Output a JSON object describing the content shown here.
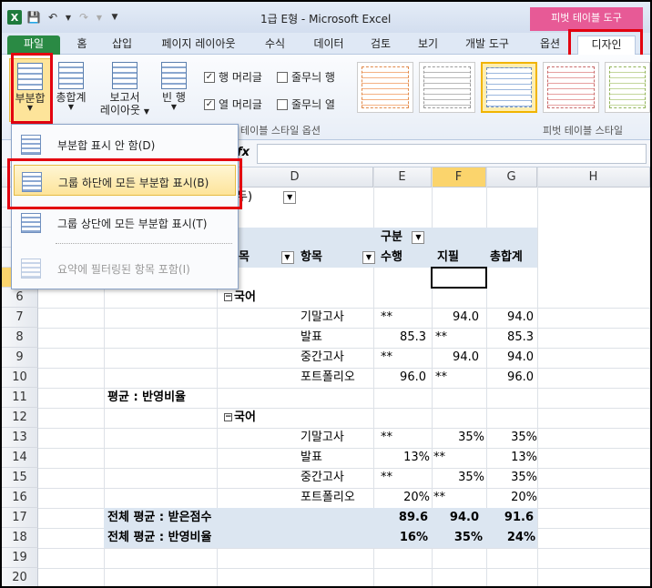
{
  "title": {
    "text": "1급 E형  -  Microsoft Excel",
    "context_group": "피벗 테이블 도구"
  },
  "tabs": [
    "파일",
    "홈",
    "삽입",
    "페이지 레이아웃",
    "수식",
    "데이터",
    "검토",
    "보기",
    "개발 도구",
    "옵션",
    "디자인"
  ],
  "ribbon": {
    "subtotal": "부분합",
    "grand_total": "총합계",
    "report_layout_1": "보고서",
    "report_layout_2": "레이아웃",
    "blank_rows": "빈 행",
    "row_headers": "행 머리글",
    "banded_rows": "줄무늬 행",
    "col_headers": "열 머리글",
    "banded_cols": "줄무늬 열",
    "style_options_group": "테이블 스타일 옵션",
    "styles_group": "피벗 테이블 스타일"
  },
  "menu": {
    "items": [
      "부분합 표시 안 함(D)",
      "그룹 하단에 모든 부분합 표시(B)",
      "그룹 상단에 모든 부분합 표시(T)",
      "요약에 필터링된 항목 포함(I)"
    ]
  },
  "formula": {
    "fx": "fx"
  },
  "columns": [
    "C",
    "D",
    "E",
    "F",
    "G",
    "H"
  ],
  "rows": [
    "6",
    "7",
    "8",
    "9",
    "10",
    "11",
    "12",
    "13",
    "14",
    "15",
    "16",
    "17",
    "18",
    "19",
    "20"
  ],
  "pivot": {
    "top_fragment": "두)",
    "col_label": "구분",
    "row_field_fragment": "목",
    "item_field": "항목",
    "col_h1": "수행",
    "col_h2": "지필",
    "col_h3": "총합계",
    "group1": "국어",
    "group2": "국어",
    "avg_label": "평균 : 반영비율",
    "block1": [
      {
        "name": "기말고사",
        "e": "**",
        "f": "94.0",
        "fmark": "",
        "g": "94.0"
      },
      {
        "name": "발표",
        "e": "85.3",
        "f": "",
        "fmark": "**",
        "g": "85.3"
      },
      {
        "name": "중간고사",
        "e": "**",
        "f": "94.0",
        "fmark": "",
        "g": "94.0"
      },
      {
        "name": "포트폴리오",
        "e": "96.0",
        "f": "",
        "fmark": "**",
        "g": "96.0"
      }
    ],
    "block2": [
      {
        "name": "기말고사",
        "e": "**",
        "f": "35%",
        "fmark": "",
        "g": "35%"
      },
      {
        "name": "발표",
        "e": "13%",
        "f": "",
        "fmark": "**",
        "g": "13%"
      },
      {
        "name": "중간고사",
        "e": "**",
        "f": "35%",
        "fmark": "",
        "g": "35%"
      },
      {
        "name": "포트폴리오",
        "e": "20%",
        "f": "",
        "fmark": "**",
        "g": "20%"
      }
    ],
    "total1": {
      "label": "전체 평균 : 받은점수",
      "e": "89.6",
      "f": "94.0",
      "g": "91.6"
    },
    "total2": {
      "label": "전체 평균 : 반영비율",
      "e": "16%",
      "f": "35%",
      "g": "24%"
    }
  },
  "colors": {
    "accent_red": "#e3000f",
    "file_tab": "#2a8a44",
    "context_tab": "#e75a96",
    "band": "#dce6f1"
  }
}
